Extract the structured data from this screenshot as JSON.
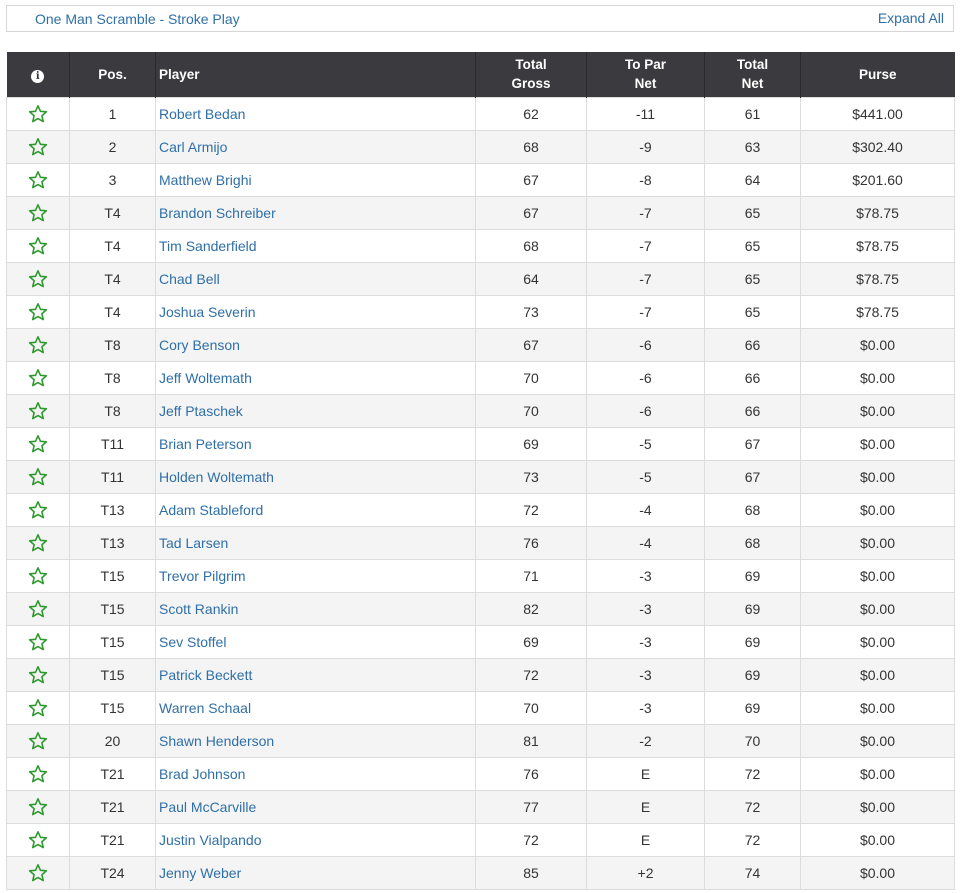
{
  "header": {
    "title": "One Man Scramble - Stroke Play",
    "expand_all": "Expand All"
  },
  "table": {
    "columns": {
      "info": "i",
      "pos": "Pos.",
      "player": "Player",
      "total_gross_1": "Total",
      "total_gross_2": "Gross",
      "to_par_net_1": "To Par",
      "to_par_net_2": "Net",
      "total_net_1": "Total",
      "total_net_2": "Net",
      "purse": "Purse"
    },
    "rows": [
      {
        "pos": "1",
        "player": "Robert Bedan",
        "gross": "62",
        "topar": "-11",
        "net": "61",
        "purse": "$441.00"
      },
      {
        "pos": "2",
        "player": "Carl Armijo",
        "gross": "68",
        "topar": "-9",
        "net": "63",
        "purse": "$302.40"
      },
      {
        "pos": "3",
        "player": "Matthew Brighi",
        "gross": "67",
        "topar": "-8",
        "net": "64",
        "purse": "$201.60"
      },
      {
        "pos": "T4",
        "player": "Brandon Schreiber",
        "gross": "67",
        "topar": "-7",
        "net": "65",
        "purse": "$78.75"
      },
      {
        "pos": "T4",
        "player": "Tim Sanderfield",
        "gross": "68",
        "topar": "-7",
        "net": "65",
        "purse": "$78.75"
      },
      {
        "pos": "T4",
        "player": "Chad Bell",
        "gross": "64",
        "topar": "-7",
        "net": "65",
        "purse": "$78.75"
      },
      {
        "pos": "T4",
        "player": "Joshua Severin",
        "gross": "73",
        "topar": "-7",
        "net": "65",
        "purse": "$78.75"
      },
      {
        "pos": "T8",
        "player": "Cory Benson",
        "gross": "67",
        "topar": "-6",
        "net": "66",
        "purse": "$0.00"
      },
      {
        "pos": "T8",
        "player": "Jeff Woltemath",
        "gross": "70",
        "topar": "-6",
        "net": "66",
        "purse": "$0.00"
      },
      {
        "pos": "T8",
        "player": "Jeff Ptaschek",
        "gross": "70",
        "topar": "-6",
        "net": "66",
        "purse": "$0.00"
      },
      {
        "pos": "T11",
        "player": "Brian Peterson",
        "gross": "69",
        "topar": "-5",
        "net": "67",
        "purse": "$0.00"
      },
      {
        "pos": "T11",
        "player": "Holden Woltemath",
        "gross": "73",
        "topar": "-5",
        "net": "67",
        "purse": "$0.00"
      },
      {
        "pos": "T13",
        "player": "Adam Stableford",
        "gross": "72",
        "topar": "-4",
        "net": "68",
        "purse": "$0.00"
      },
      {
        "pos": "T13",
        "player": "Tad Larsen",
        "gross": "76",
        "topar": "-4",
        "net": "68",
        "purse": "$0.00"
      },
      {
        "pos": "T15",
        "player": "Trevor Pilgrim",
        "gross": "71",
        "topar": "-3",
        "net": "69",
        "purse": "$0.00"
      },
      {
        "pos": "T15",
        "player": "Scott Rankin",
        "gross": "82",
        "topar": "-3",
        "net": "69",
        "purse": "$0.00"
      },
      {
        "pos": "T15",
        "player": "Sev Stoffel",
        "gross": "69",
        "topar": "-3",
        "net": "69",
        "purse": "$0.00"
      },
      {
        "pos": "T15",
        "player": "Patrick Beckett",
        "gross": "72",
        "topar": "-3",
        "net": "69",
        "purse": "$0.00"
      },
      {
        "pos": "T15",
        "player": "Warren Schaal",
        "gross": "70",
        "topar": "-3",
        "net": "69",
        "purse": "$0.00"
      },
      {
        "pos": "20",
        "player": "Shawn Henderson",
        "gross": "81",
        "topar": "-2",
        "net": "70",
        "purse": "$0.00"
      },
      {
        "pos": "T21",
        "player": "Brad Johnson",
        "gross": "76",
        "topar": "E",
        "net": "72",
        "purse": "$0.00"
      },
      {
        "pos": "T21",
        "player": "Paul McCarville",
        "gross": "77",
        "topar": "E",
        "net": "72",
        "purse": "$0.00"
      },
      {
        "pos": "T21",
        "player": "Justin Vialpando",
        "gross": "72",
        "topar": "E",
        "net": "72",
        "purse": "$0.00"
      },
      {
        "pos": "T24",
        "player": "Jenny Weber",
        "gross": "85",
        "topar": "+2",
        "net": "74",
        "purse": "$0.00"
      }
    ]
  },
  "icons": {
    "info": "info-circle-icon",
    "favorite": "star-outline-icon"
  },
  "colors": {
    "header_bg": "#3b3b3f",
    "link": "#2f6fa8",
    "star": "#2e9a2e",
    "row_alt": "#f4f4f4"
  }
}
